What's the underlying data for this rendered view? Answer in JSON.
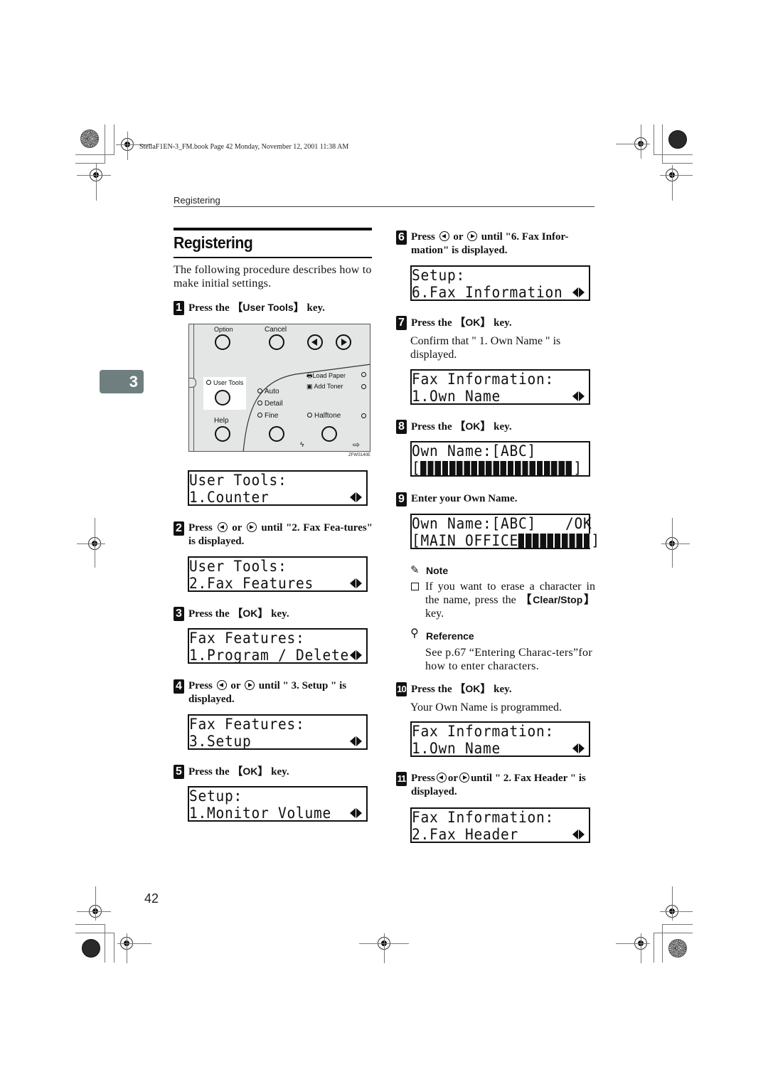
{
  "print_header": {
    "file_info": "StellaF1EN-3_FM.book  Page 42  Monday, November 12, 2001  11:38 AM"
  },
  "running_head": "Registering",
  "chapter_tab": "3",
  "section": {
    "title": "Registering",
    "intro": "The following procedure describes how to make initial settings."
  },
  "panel": {
    "labels": {
      "option": "Option",
      "cancel": "Cancel",
      "user_tools": "User Tools",
      "help": "Help",
      "auto": "Auto",
      "detail": "Detail",
      "fine": "Fine",
      "halftone": "Halftone",
      "load_paper": "Load Paper",
      "add_toner": "Add Toner"
    },
    "figure_code": "ZFWS140E"
  },
  "steps": [
    {
      "num": "1",
      "pre": "Press the ",
      "key": "User Tools",
      "post": " key."
    },
    {
      "num": "2",
      "pre": "Press",
      "mid": "or",
      "post": "until \"2. Fax Fea-tures\" is displayed."
    },
    {
      "num": "3",
      "pre": "Press the ",
      "key": "OK",
      "post": " key."
    },
    {
      "num": "4",
      "pre": "Press",
      "mid": "or",
      "post": "until \" 3. Setup \" is displayed."
    },
    {
      "num": "5",
      "pre": "Press the ",
      "key": "OK",
      "post": " key."
    },
    {
      "num": "6",
      "pre": "Press",
      "mid": "or",
      "post": "until \"6. Fax Infor-mation\" is displayed."
    },
    {
      "num": "7",
      "pre": "Press the ",
      "key": "OK",
      "post": " key.",
      "body": "Confirm that \" 1. Own Name \" is displayed."
    },
    {
      "num": "8",
      "pre": "Press the ",
      "key": "OK",
      "post": " key."
    },
    {
      "num": "9",
      "text": "Enter your Own Name."
    },
    {
      "num": "10",
      "pre": "Press the ",
      "key": "OK",
      "post": " key.",
      "body": "Your Own Name is programmed."
    },
    {
      "num": "11",
      "pre": "Press",
      "mid": "or",
      "post": "until \" 2. Fax Header \" is displayed."
    }
  ],
  "lcd": {
    "d1": {
      "line1": "User Tools:",
      "line2": "1.Counter"
    },
    "d2": {
      "line1": "User Tools:",
      "line2": "2.Fax Features"
    },
    "d3": {
      "line1": "Fax Features:",
      "line2": "1.Program / Delete"
    },
    "d4": {
      "line1": "Fax Features:",
      "line2": "3.Setup"
    },
    "d5": {
      "line1": "Setup:",
      "line2": "1.Monitor Volume"
    },
    "d6": {
      "line1": "Setup:",
      "line2": "6.Fax Information"
    },
    "d7": {
      "line1": "Fax Information:",
      "line2": "1.Own Name"
    },
    "d8": {
      "line1": "Own Name:[ABC]",
      "line2_open": "[",
      "line2_close": "]"
    },
    "d9": {
      "line1": "Own Name:[ABC]",
      "line1_right": "/OK",
      "line2_open": "[",
      "line2_text": "MAIN OFFICE",
      "line2_close": "]"
    },
    "d10": {
      "line1": "Fax Information:",
      "line2": "1.Own Name"
    },
    "d11": {
      "line1": "Fax Information:",
      "line2": "2.Fax Header"
    }
  },
  "note": {
    "title": "Note",
    "text_pre": "If you want to erase a character in the name, press the ",
    "key": "Clear/Stop",
    "text_post": " key."
  },
  "reference": {
    "title": "Reference",
    "text": "See p.67 “Entering Charac-ters”for how to enter characters."
  },
  "page_number": "42"
}
